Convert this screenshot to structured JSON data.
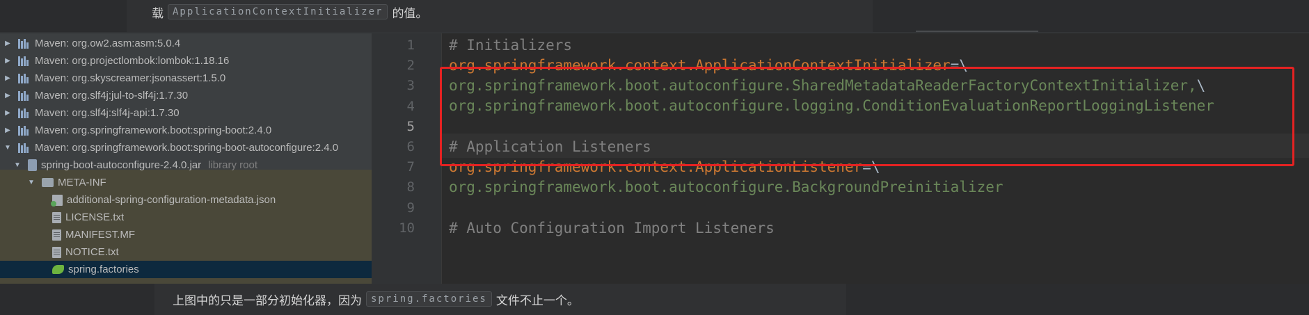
{
  "article": {
    "top_prefix": "载",
    "top_code": "ApplicationContextInitializer",
    "top_suffix": "的值。",
    "bottom_prefix": "上图中的只是一部分初始化器，因为",
    "bottom_code": "spring.factories",
    "bottom_suffix": "文件不止一个。"
  },
  "tree": {
    "items": [
      {
        "label": "Maven: org.ow2.asm:asm:5.0.4",
        "expanded": false,
        "icon": "maven-library-icon"
      },
      {
        "label": "Maven: org.projectlombok:lombok:1.18.16",
        "expanded": false,
        "icon": "maven-library-icon"
      },
      {
        "label": "Maven: org.skyscreamer:jsonassert:1.5.0",
        "expanded": false,
        "icon": "maven-library-icon"
      },
      {
        "label": "Maven: org.slf4j:jul-to-slf4j:1.7.30",
        "expanded": false,
        "icon": "maven-library-icon"
      },
      {
        "label": "Maven: org.slf4j:slf4j-api:1.7.30",
        "expanded": false,
        "icon": "maven-library-icon"
      },
      {
        "label": "Maven: org.springframework.boot:spring-boot:2.4.0",
        "expanded": false,
        "icon": "maven-library-icon"
      },
      {
        "label": "Maven: org.springframework.boot:spring-boot-autoconfigure:2.4.0",
        "expanded": true,
        "icon": "maven-library-icon"
      },
      {
        "label": "spring-boot-autoconfigure-2.4.0.jar",
        "suffix": "library root",
        "expanded": true,
        "icon": "jar-icon"
      },
      {
        "label": "META-INF",
        "expanded": true,
        "icon": "folder-icon"
      },
      {
        "label": "additional-spring-configuration-metadata.json",
        "icon": "json-file-icon"
      },
      {
        "label": "LICENSE.txt",
        "icon": "text-file-icon"
      },
      {
        "label": "MANIFEST.MF",
        "icon": "manifest-file-icon"
      },
      {
        "label": "NOTICE.txt",
        "icon": "text-file-icon"
      },
      {
        "label": "spring.factories",
        "icon": "spring-factories-icon",
        "selected": true
      }
    ]
  },
  "editor": {
    "line_numbers": [
      "1",
      "2",
      "3",
      "4",
      "5",
      "6",
      "7",
      "8",
      "9",
      "10"
    ],
    "current_line": "5",
    "lines": {
      "l1": "# Initializers",
      "l2_key": "org.springframework.context.ApplicationContextInitializer",
      "l2_op": "=\\",
      "l3_val": "org.springframework.boot.autoconfigure.SharedMetadataReaderFactoryContextInitializer,",
      "l3_op": "\\",
      "l4_val": "org.springframework.boot.autoconfigure.logging.ConditionEvaluationReportLoggingListener",
      "l6": "# Application Listeners",
      "l7_key": "org.springframework.context.ApplicationListener",
      "l7_op": "=\\",
      "l8_val": "org.springframework.boot.autoconfigure.BackgroundPreinitializer",
      "l10": "# Auto Configuration Import Listeners"
    }
  },
  "colors": {
    "comment": "#808080",
    "property_key": "#cc7832",
    "property_value": "#6a8759",
    "highlight_border": "#e52222",
    "selection": "#0d293e"
  }
}
